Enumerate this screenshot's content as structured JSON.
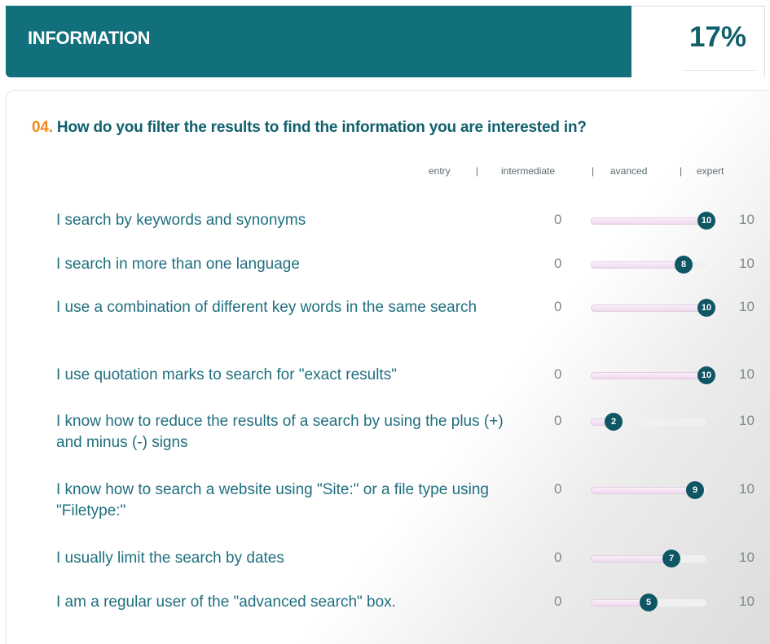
{
  "header": {
    "title": "INFORMATION",
    "percent": "17%"
  },
  "question": {
    "number": "04.",
    "text": "How do you filter the results to find the information you are interested in?"
  },
  "scale_labels": [
    "entry",
    "|",
    "intermediate",
    "|",
    "avanced",
    "|",
    "expert"
  ],
  "slider_min": 0,
  "slider_max": 10,
  "items": [
    {
      "label": "I search by keywords and synonyms",
      "min": "0",
      "max": "10",
      "value": 10
    },
    {
      "label": "I search in more than one language",
      "min": "0",
      "max": "10",
      "value": 8
    },
    {
      "label": "I use a combination of different key words in the same search",
      "min": "0",
      "max": "10",
      "value": 10
    },
    {
      "label": "I use quotation marks to search for \"exact results\"",
      "min": "0",
      "max": "10",
      "value": 10
    },
    {
      "label": "I know how to reduce the results of a search by using the plus (+) and minus (-) signs",
      "min": "0",
      "max": "10",
      "value": 2
    },
    {
      "label": "I know how to search a website using \"Site:\" or a file type using \"Filetype:\"",
      "min": "0",
      "max": "10",
      "value": 9
    },
    {
      "label": "I usually limit the search by dates",
      "min": "0",
      "max": "10",
      "value": 7
    },
    {
      "label": "I am a regular user of the \"advanced search\" box.",
      "min": "0",
      "max": "10",
      "value": 5
    }
  ],
  "colors": {
    "header_bg": "#126f7c",
    "accent_orange": "#f08a1c",
    "knob": "#0f5665",
    "label_text": "#1f6f7f"
  }
}
